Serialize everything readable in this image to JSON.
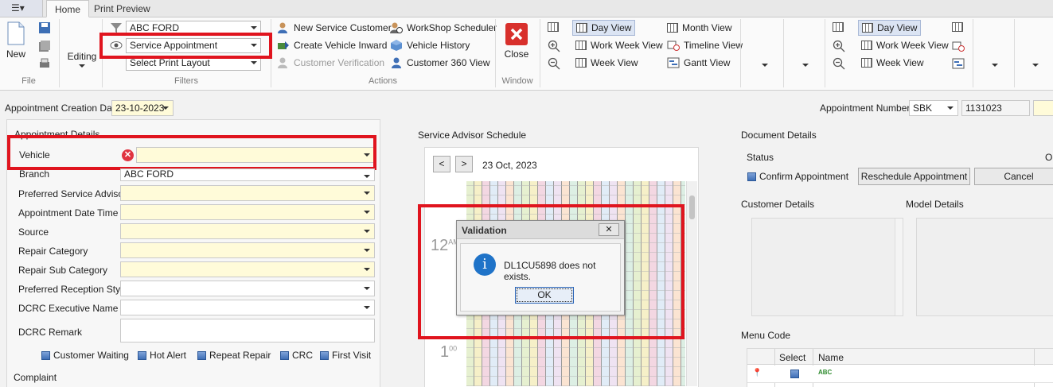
{
  "tabs": {
    "home": "Home",
    "print_preview": "Print Preview"
  },
  "ribbon": {
    "new": "New",
    "editing": "Editing",
    "file_label": "File",
    "filters_label": "Filters",
    "actions_label": "Actions",
    "window_label": "Window",
    "filter_dealer": "ABC FORD",
    "filter_form": "Service Appointment",
    "filter_print": "Select Print Layout",
    "actions": {
      "new_customer": "New Service Customer",
      "create_inward": "Create Vehicle Inward",
      "customer_verification": "Customer Verification",
      "workshop_scheduler": "WorkShop Scheduler",
      "vehicle_history": "Vehicle History",
      "customer_360": "Customer 360 View"
    },
    "close": "Close",
    "views1": {
      "day": "Day View",
      "work_week": "Work Week View",
      "week": "Week View",
      "month": "Month View",
      "timeline": "Timeline View",
      "gantt": "Gantt View"
    },
    "views2": {
      "day": "Day View",
      "work_week": "Work Week View",
      "week": "Week View"
    }
  },
  "form": {
    "creation_date_label": "Appointment Creation Date",
    "creation_date_value": "23-10-2023",
    "appt_number_label": "Appointment Number",
    "appt_prefix": "SBK",
    "appt_number": "1131023",
    "section_title": "Appointment Details",
    "fields": {
      "vehicle": "Vehicle",
      "branch": "Branch",
      "branch_value": "ABC FORD",
      "advisor": "Preferred Service Advisor",
      "datetime": "Appointment Date Time",
      "source": "Source",
      "repair_category": "Repair Category",
      "repair_sub_category": "Repair Sub Category",
      "reception_style": "Preferred Reception Style",
      "dcrc_exec": "DCRC Executive Name",
      "dcrc_remark": "DCRC Remark"
    },
    "checks": {
      "customer_waiting": "Customer Waiting",
      "hot_alert": "Hot Alert",
      "repeat_repair": "Repeat Repair",
      "crc": "CRC",
      "first_visit": "First Visit"
    },
    "complaint": "Complaint"
  },
  "schedule": {
    "title": "Service Advisor Schedule",
    "date": "23 Oct, 2023",
    "hour12": "12",
    "hour12_suffix": "AM",
    "hour1": "1",
    "hour1_suffix": "00"
  },
  "document": {
    "title": "Document Details",
    "status_label": "Status",
    "status_value": "Op",
    "confirm": "Confirm Appointment",
    "reschedule": "Reschedule Appointment",
    "cancel": "Cancel",
    "customer_details": "Customer Details",
    "model_details": "Model Details",
    "menu_code": "Menu Code",
    "col_select": "Select",
    "col_name": "Name"
  },
  "dialog": {
    "title": "Validation",
    "message": "DL1CU5898 does not exists.",
    "ok": "OK",
    "close_glyph": "✕"
  },
  "colors": {
    "highlight_red": "#e0141e",
    "field_yellow": "#fffbd9",
    "selected_view": "#dbe4f3"
  }
}
